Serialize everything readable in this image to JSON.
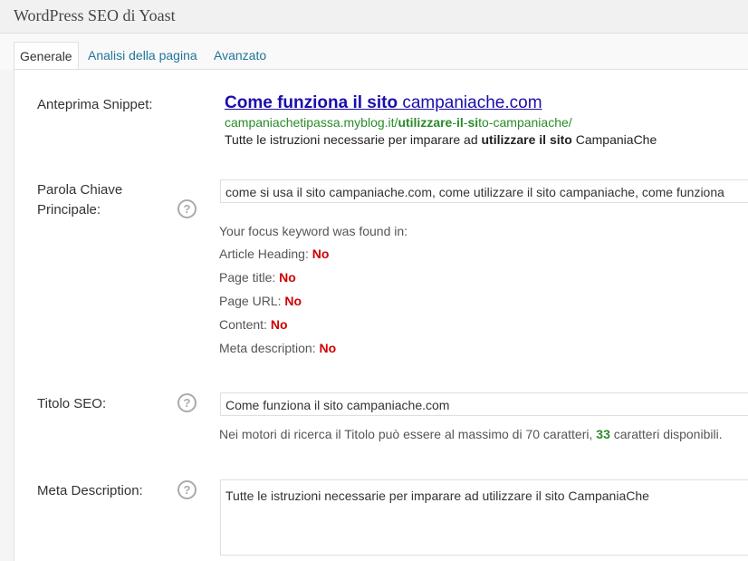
{
  "header": {
    "title": "WordPress SEO di Yoast"
  },
  "tabs": [
    {
      "label": "Generale"
    },
    {
      "label": "Analisi della pagina"
    },
    {
      "label": "Avanzato"
    }
  ],
  "snippet": {
    "label": "Anteprima Snippet:",
    "title_bold": "Come funziona il sito",
    "title_rest": " campaniache.com",
    "url_pre": "campaniachetipassa.myblog.it/",
    "url_bold1": "utilizzare",
    "url_mid1": "-",
    "url_bold2": "il",
    "url_mid2": "-",
    "url_bold3": "si",
    "url_rest": "to-campaniache/",
    "desc_pre": "Tutte le istruzioni necessarie per imparare ad ",
    "desc_bold": "utilizzare il sito",
    "desc_rest": " CampaniaChe"
  },
  "focus": {
    "label_line1": "Parola Chiave",
    "label_line2": "Principale:",
    "help": "?",
    "value": "come si usa il sito campaniache.com, come utilizzare il sito campaniache, come funziona",
    "found_intro": "Your focus keyword was found in:",
    "checks": [
      {
        "label": "Article Heading:",
        "value": "No"
      },
      {
        "label": "Page title:",
        "value": "No"
      },
      {
        "label": "Page URL:",
        "value": "No"
      },
      {
        "label": "Content:",
        "value": "No"
      },
      {
        "label": "Meta description:",
        "value": "No"
      }
    ]
  },
  "seo_title": {
    "label": "Titolo SEO:",
    "help": "?",
    "value": "Come funziona il sito campaniache.com",
    "hint_pre": "Nei motori di ricerca il Titolo può essere al massimo di 70 caratteri, ",
    "hint_count": "33",
    "hint_post": " caratteri disponibili."
  },
  "meta": {
    "label": "Meta Description:",
    "help": "?",
    "value": "Tutte le istruzioni necessarie per imparare ad utilizzare il sito CampaniaChe"
  }
}
